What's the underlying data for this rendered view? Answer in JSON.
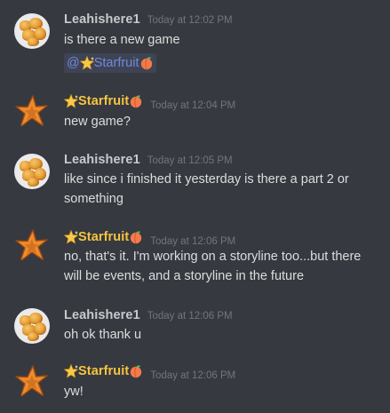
{
  "messages": [
    {
      "author": "Leahishere1",
      "time": "Today at 12:02 PM",
      "lines": [
        "is there a new game"
      ],
      "mention": {
        "at": "@",
        "name": "Starfruit"
      }
    },
    {
      "author": "Starfruit",
      "time": "Today at 12:04 PM",
      "lines": [
        "new game?"
      ]
    },
    {
      "author": "Leahishere1",
      "time": "Today at 12:05 PM",
      "lines": [
        "like since i finished it yesterday is there a part 2 or something"
      ]
    },
    {
      "author": "Starfruit",
      "time": "Today at 12:06 PM",
      "lines": [
        "no, that's it. I'm working on a storyline too...but there will be events, and a storyline in the future"
      ]
    },
    {
      "author": "Leahishere1",
      "time": "Today at 12:06 PM",
      "lines": [
        "oh ok thank u"
      ]
    },
    {
      "author": "Starfruit",
      "time": "Today at 12:06 PM",
      "lines": [
        "yw!"
      ]
    }
  ],
  "icons": {
    "star_avatar": "orange-starfish-icon",
    "nugget_avatar": "chicken-nuggets-icon",
    "name_prefix": "sparkle-star-icon",
    "name_suffix": "peach-icon"
  },
  "colors": {
    "background": "#36393f",
    "username": "#c7c9cc",
    "star_username": "#f5c542",
    "timestamp": "#72767d",
    "message_text": "#dcddde",
    "mention_text": "#7289da",
    "mention_bg": "rgba(114,137,218,0.15)"
  }
}
